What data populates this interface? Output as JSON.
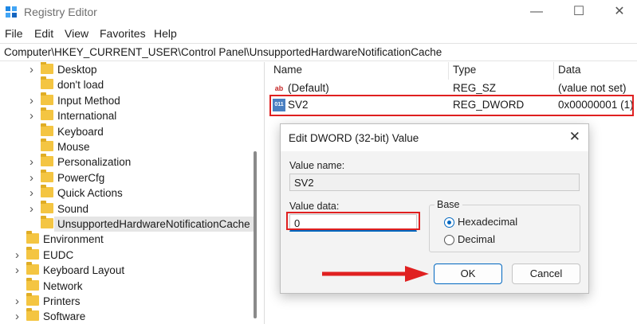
{
  "window": {
    "title": "Registry Editor"
  },
  "menu": [
    "File",
    "Edit",
    "View",
    "Favorites",
    "Help"
  ],
  "address": "Computer\\HKEY_CURRENT_USER\\Control Panel\\UnsupportedHardwareNotificationCache",
  "tree": [
    {
      "label": "Desktop",
      "expandable": true
    },
    {
      "label": "don't load",
      "expandable": false
    },
    {
      "label": "Input Method",
      "expandable": true
    },
    {
      "label": "International",
      "expandable": true
    },
    {
      "label": "Keyboard",
      "expandable": false
    },
    {
      "label": "Mouse",
      "expandable": false
    },
    {
      "label": "Personalization",
      "expandable": true
    },
    {
      "label": "PowerCfg",
      "expandable": true
    },
    {
      "label": "Quick Actions",
      "expandable": true
    },
    {
      "label": "Sound",
      "expandable": true
    },
    {
      "label": "UnsupportedHardwareNotificationCache",
      "expandable": false,
      "selected": true
    },
    {
      "label": "Environment",
      "expandable": false,
      "top": true
    },
    {
      "label": "EUDC",
      "expandable": true,
      "top": true
    },
    {
      "label": "Keyboard Layout",
      "expandable": true,
      "top": true
    },
    {
      "label": "Network",
      "expandable": false,
      "top": true
    },
    {
      "label": "Printers",
      "expandable": true,
      "top": true
    },
    {
      "label": "Software",
      "expandable": true,
      "top": true
    }
  ],
  "list": {
    "columns": [
      "Name",
      "Type",
      "Data"
    ],
    "rows": [
      {
        "icon": "string-value-icon",
        "glyph": "ab",
        "name": "(Default)",
        "type": "REG_SZ",
        "data": "(value not set)"
      },
      {
        "icon": "binary-value-icon",
        "glyph": "011",
        "name": "SV2",
        "type": "REG_DWORD",
        "data": "0x00000001 (1)"
      }
    ]
  },
  "dialog": {
    "title": "Edit DWORD (32-bit) Value",
    "value_name_label": "Value name:",
    "value_name": "SV2",
    "value_data_label": "Value data:",
    "value_data": "0",
    "base_label": "Base",
    "hex_label": "Hexadecimal",
    "dec_label": "Decimal",
    "ok_label": "OK",
    "cancel_label": "Cancel"
  },
  "colors": {
    "highlight": "#e02020",
    "accent": "#0067c0",
    "folder": "#f4c542"
  }
}
